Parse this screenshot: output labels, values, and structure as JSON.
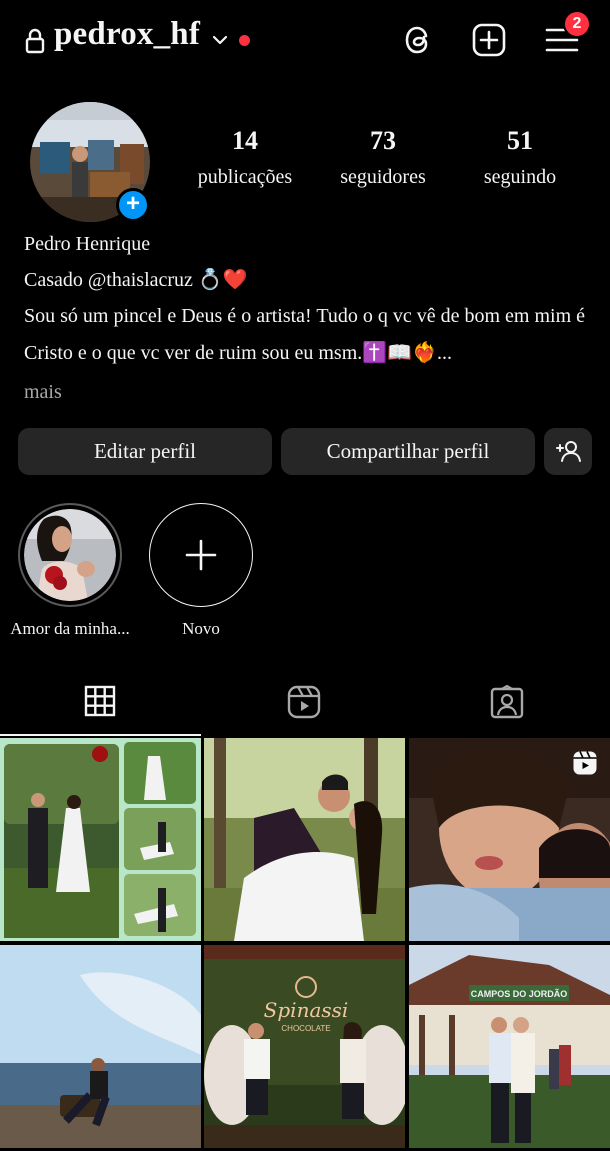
{
  "header": {
    "username": "pedrox_hf",
    "notification_count": "2",
    "icons": [
      "lock-icon",
      "chevron-down-icon",
      "threads-icon",
      "add-post-icon",
      "menu-icon"
    ],
    "accent_red": "#ff3040"
  },
  "profile": {
    "stats": [
      {
        "value": "14",
        "label": "publicações"
      },
      {
        "value": "73",
        "label": "seguidores"
      },
      {
        "value": "51",
        "label": "seguindo"
      }
    ],
    "name": "Pedro Henrique",
    "bio_line_1": "Casado @thaislacruz 💍❤️",
    "bio_line_2": "Sou só um pincel e Deus é o artista! Tudo o q vc vê de bom em mim é Cristo e o que vc ver de ruim sou eu msm.✝️📖❤️‍🔥...",
    "more_label": "mais"
  },
  "buttons": {
    "edit_label": "Editar perfil",
    "share_label": "Compartilhar perfil",
    "discover_icon": "add-person-icon"
  },
  "highlights": [
    {
      "label": "Amor da minha..."
    },
    {
      "label": "Novo"
    }
  ],
  "tabs": [
    "grid-icon",
    "reels-icon",
    "tagged-icon"
  ],
  "colors": {
    "button_bg": "#262626",
    "blue": "#0095f6",
    "muted": "#a8a8a8"
  }
}
